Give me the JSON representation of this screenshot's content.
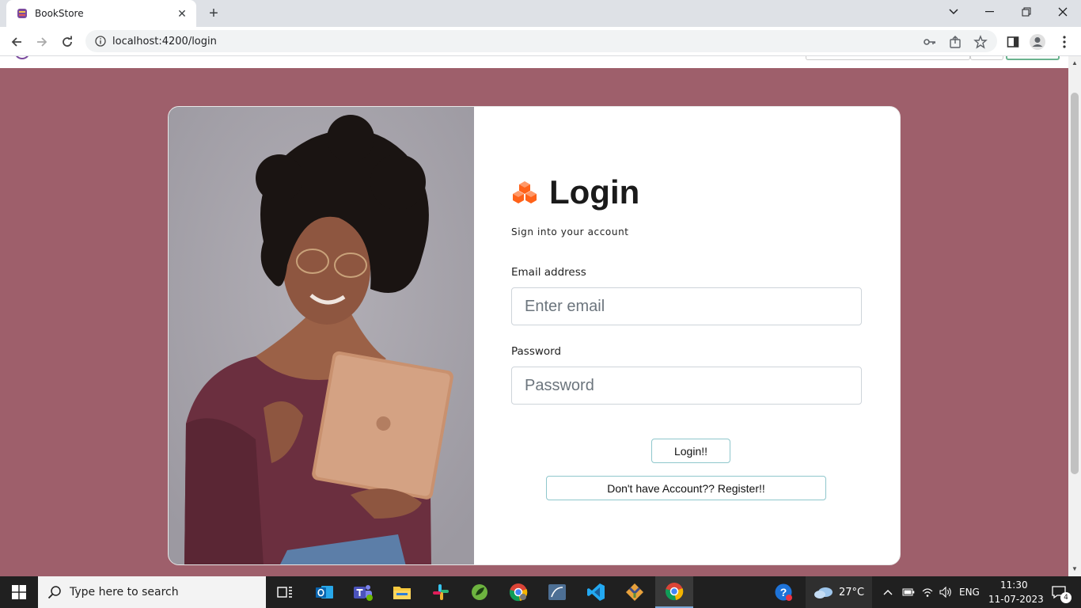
{
  "browser": {
    "tab_title": "BookStore",
    "url": "localhost:4200/login"
  },
  "login": {
    "title": "Login",
    "subtitle": "Sign into your account",
    "email_label": "Email address",
    "email_placeholder": "Enter email",
    "password_label": "Password",
    "password_placeholder": "Password",
    "login_button": "Login!!",
    "register_button": "Don't have Account?? Register!!",
    "logo_color": "#ff6219"
  },
  "colors": {
    "page_background": "#9e5f6b",
    "button_border": "#8fc7cc"
  },
  "taskbar": {
    "search_placeholder": "Type here to search",
    "weather": "27°C",
    "language": "ENG",
    "time": "11:30",
    "date": "11-07-2023",
    "notification_count": "4"
  }
}
